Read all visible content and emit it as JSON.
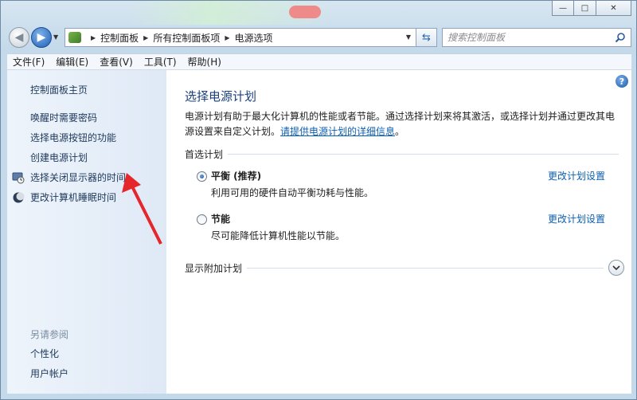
{
  "window": {
    "caption_minimize": "—",
    "caption_maximize": "□",
    "caption_close": "✕"
  },
  "address": {
    "crumbs": [
      "控制面板",
      "所有控制面板项",
      "电源选项"
    ]
  },
  "search": {
    "placeholder": "搜索控制面板"
  },
  "menu": [
    "文件(F)",
    "编辑(E)",
    "查看(V)",
    "工具(T)",
    "帮助(H)"
  ],
  "sidebar": {
    "home": "控制面板主页",
    "links": [
      "唤醒时需要密码",
      "选择电源按钮的功能",
      "创建电源计划"
    ],
    "icon_links": [
      "选择关闭显示器的时间",
      "更改计算机睡眠时间"
    ],
    "see_also_title": "另请参阅",
    "see_also": [
      "个性化",
      "用户帐户"
    ]
  },
  "main": {
    "title": "选择电源计划",
    "desc_line1": "电源计划有助于最大化计算机的性能或者节能。通过选择计划来将其激活，或选择计划并通过更改其电",
    "desc_line2_prefix": "源设置来自定义计划。",
    "desc_link": "请提供电源计划的详细信息",
    "desc_line2_suffix": "。",
    "preferred_group": "首选计划",
    "plans": [
      {
        "name": "平衡 (推荐)",
        "desc": "利用可用的硬件自动平衡功耗与性能。",
        "link": "更改计划设置",
        "selected": true
      },
      {
        "name": "节能",
        "desc": "尽可能降低计算机性能以节能。",
        "link": "更改计划设置",
        "selected": false
      }
    ],
    "more_plans": "显示附加计划",
    "help": "?"
  },
  "colors": {
    "link": "#0b5fb3",
    "title": "#1a3f7a",
    "annotation_arrow": "#e5262a"
  }
}
